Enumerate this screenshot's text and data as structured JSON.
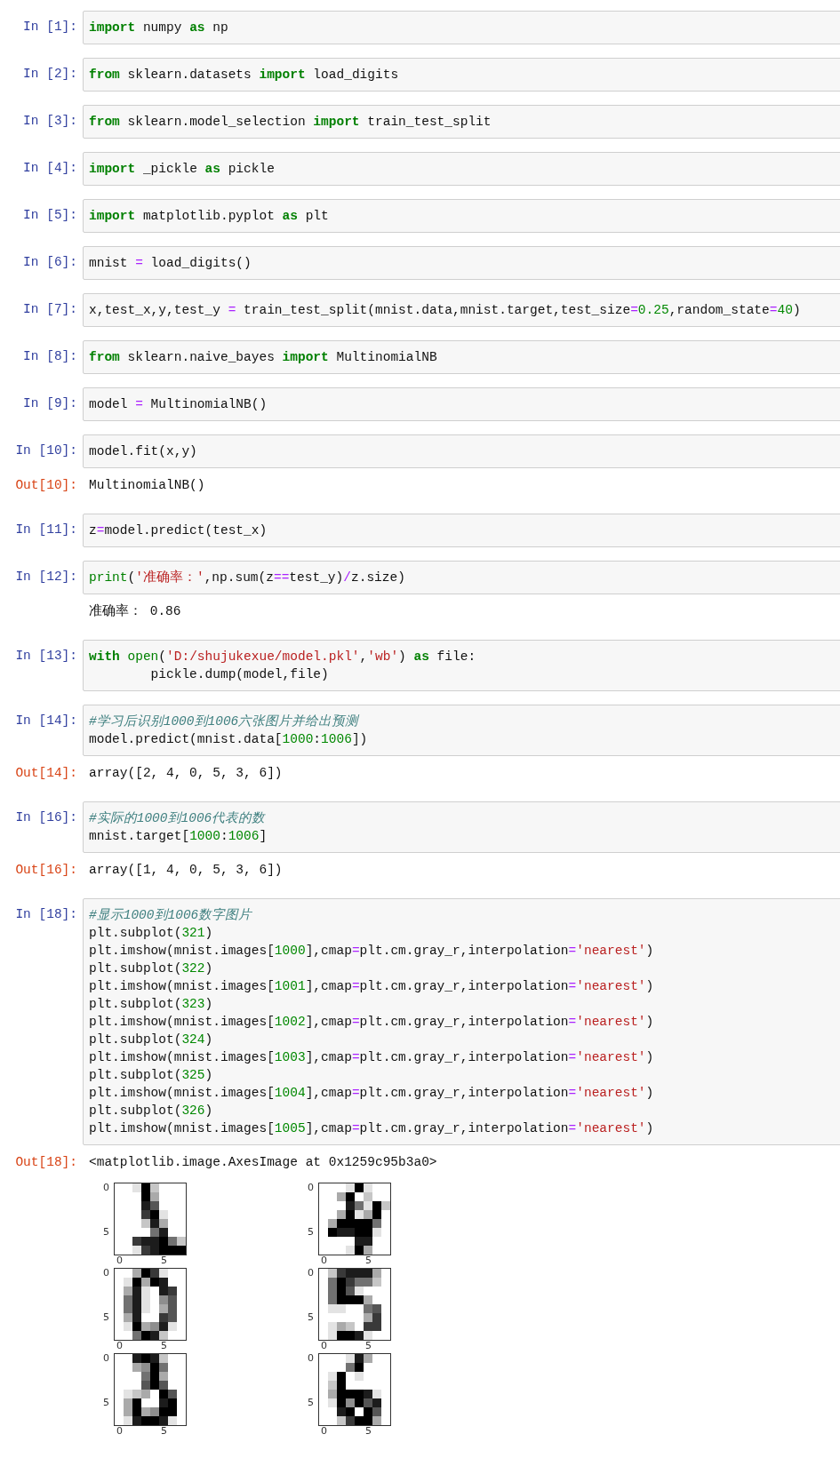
{
  "cells": [
    {
      "prompt": "In [1]:",
      "code": [
        [
          {
            "kind": "kw",
            "text": "import"
          },
          {
            "kind": "plain",
            "text": " numpy "
          },
          {
            "kind": "kw",
            "text": "as"
          },
          {
            "kind": "plain",
            "text": " np"
          }
        ]
      ]
    },
    {
      "prompt": "In [2]:",
      "code": [
        [
          {
            "kind": "kw",
            "text": "from"
          },
          {
            "kind": "plain",
            "text": " sklearn.datasets "
          },
          {
            "kind": "kw",
            "text": "import"
          },
          {
            "kind": "plain",
            "text": " load_digits"
          }
        ]
      ]
    },
    {
      "prompt": "In [3]:",
      "code": [
        [
          {
            "kind": "kw",
            "text": "from"
          },
          {
            "kind": "plain",
            "text": " sklearn.model_selection "
          },
          {
            "kind": "kw",
            "text": "import"
          },
          {
            "kind": "plain",
            "text": " train_test_split"
          }
        ]
      ]
    },
    {
      "prompt": "In [4]:",
      "code": [
        [
          {
            "kind": "kw",
            "text": "import"
          },
          {
            "kind": "plain",
            "text": " _pickle "
          },
          {
            "kind": "kw",
            "text": "as"
          },
          {
            "kind": "plain",
            "text": " pickle"
          }
        ]
      ]
    },
    {
      "prompt": "In [5]:",
      "code": [
        [
          {
            "kind": "kw",
            "text": "import"
          },
          {
            "kind": "plain",
            "text": " matplotlib.pyplot "
          },
          {
            "kind": "kw",
            "text": "as"
          },
          {
            "kind": "plain",
            "text": " plt"
          }
        ]
      ]
    },
    {
      "prompt": "In [6]:",
      "code": [
        [
          {
            "kind": "plain",
            "text": "mnist "
          },
          {
            "kind": "op",
            "text": "="
          },
          {
            "kind": "plain",
            "text": " load_digits()"
          }
        ]
      ]
    },
    {
      "prompt": "In [7]:",
      "code": [
        [
          {
            "kind": "plain",
            "text": "x,test_x,y,test_y "
          },
          {
            "kind": "op",
            "text": "="
          },
          {
            "kind": "plain",
            "text": " train_test_split(mnist.data,mnist.target,test_size"
          },
          {
            "kind": "op",
            "text": "="
          },
          {
            "kind": "num",
            "text": "0.25"
          },
          {
            "kind": "plain",
            "text": ",random_state"
          },
          {
            "kind": "op",
            "text": "="
          },
          {
            "kind": "num",
            "text": "40"
          },
          {
            "kind": "plain",
            "text": ")"
          }
        ]
      ]
    },
    {
      "prompt": "In [8]:",
      "code": [
        [
          {
            "kind": "kw",
            "text": "from"
          },
          {
            "kind": "plain",
            "text": " sklearn.naive_bayes "
          },
          {
            "kind": "kw",
            "text": "import"
          },
          {
            "kind": "plain",
            "text": " MultinomialNB"
          }
        ]
      ]
    },
    {
      "prompt": "In [9]:",
      "code": [
        [
          {
            "kind": "plain",
            "text": "model "
          },
          {
            "kind": "op",
            "text": "="
          },
          {
            "kind": "plain",
            "text": " MultinomialNB()"
          }
        ]
      ]
    },
    {
      "prompt": "In [10]:",
      "code": [
        [
          {
            "kind": "plain",
            "text": "model.fit(x,y)"
          }
        ]
      ],
      "outputs": [
        {
          "kind": "text",
          "prompt": "Out[10]:",
          "text": "MultinomialNB()"
        }
      ]
    },
    {
      "prompt": "In [11]:",
      "code": [
        [
          {
            "kind": "plain",
            "text": "z"
          },
          {
            "kind": "op",
            "text": "="
          },
          {
            "kind": "plain",
            "text": "model.predict(test_x)"
          }
        ]
      ]
    },
    {
      "prompt": "In [12]:",
      "code": [
        [
          {
            "kind": "builtin",
            "text": "print"
          },
          {
            "kind": "plain",
            "text": "("
          },
          {
            "kind": "str",
            "text": "'准确率：'"
          },
          {
            "kind": "plain",
            "text": ",np.sum(z"
          },
          {
            "kind": "op",
            "text": "=="
          },
          {
            "kind": "plain",
            "text": "test_y)"
          },
          {
            "kind": "op",
            "text": "/"
          },
          {
            "kind": "plain",
            "text": "z.size)"
          }
        ]
      ],
      "outputs": [
        {
          "kind": "text",
          "text": "准确率： 0.86"
        }
      ]
    },
    {
      "prompt": "In [13]:",
      "code": [
        [
          {
            "kind": "kw",
            "text": "with"
          },
          {
            "kind": "builtin",
            "text": " open"
          },
          {
            "kind": "plain",
            "text": "("
          },
          {
            "kind": "str",
            "text": "'D:/shujukexue/model.pkl'"
          },
          {
            "kind": "plain",
            "text": ","
          },
          {
            "kind": "str",
            "text": "'wb'"
          },
          {
            "kind": "plain",
            "text": ") "
          },
          {
            "kind": "kw",
            "text": "as"
          },
          {
            "kind": "plain",
            "text": " file:"
          }
        ],
        [
          {
            "kind": "plain",
            "text": "        pickle.dump(model,file)"
          }
        ]
      ]
    },
    {
      "prompt": "In [14]:",
      "code": [
        [
          {
            "kind": "comment",
            "text": "#学习后识别1000到1006六张图片并给出预测"
          }
        ],
        [
          {
            "kind": "plain",
            "text": "model.predict(mnist.data["
          },
          {
            "kind": "num",
            "text": "1000"
          },
          {
            "kind": "plain",
            "text": ":"
          },
          {
            "kind": "num",
            "text": "1006"
          },
          {
            "kind": "plain",
            "text": "])"
          }
        ]
      ],
      "outputs": [
        {
          "kind": "text",
          "prompt": "Out[14]:",
          "text": "array([2, 4, 0, 5, 3, 6])"
        }
      ]
    },
    {
      "prompt": "In [16]:",
      "code": [
        [
          {
            "kind": "comment",
            "text": "#实际的1000到1006代表的数"
          }
        ],
        [
          {
            "kind": "plain",
            "text": "mnist.target["
          },
          {
            "kind": "num",
            "text": "1000"
          },
          {
            "kind": "plain",
            "text": ":"
          },
          {
            "kind": "num",
            "text": "1006"
          },
          {
            "kind": "plain",
            "text": "]"
          }
        ]
      ],
      "outputs": [
        {
          "kind": "text",
          "prompt": "Out[16]:",
          "text": "array([1, 4, 0, 5, 3, 6])"
        }
      ]
    },
    {
      "prompt": "In [18]:",
      "code": [
        [
          {
            "kind": "comment",
            "text": "#显示1000到1006数字图片"
          }
        ],
        [
          {
            "kind": "plain",
            "text": "plt.subplot("
          },
          {
            "kind": "num",
            "text": "321"
          },
          {
            "kind": "plain",
            "text": ")"
          }
        ],
        [
          {
            "kind": "plain",
            "text": "plt.imshow(mnist.images["
          },
          {
            "kind": "num",
            "text": "1000"
          },
          {
            "kind": "plain",
            "text": "],cmap"
          },
          {
            "kind": "op",
            "text": "="
          },
          {
            "kind": "plain",
            "text": "plt.cm.gray_r,interpolation"
          },
          {
            "kind": "op",
            "text": "="
          },
          {
            "kind": "str",
            "text": "'nearest'"
          },
          {
            "kind": "plain",
            "text": ")"
          }
        ],
        [
          {
            "kind": "plain",
            "text": "plt.subplot("
          },
          {
            "kind": "num",
            "text": "322"
          },
          {
            "kind": "plain",
            "text": ")"
          }
        ],
        [
          {
            "kind": "plain",
            "text": "plt.imshow(mnist.images["
          },
          {
            "kind": "num",
            "text": "1001"
          },
          {
            "kind": "plain",
            "text": "],cmap"
          },
          {
            "kind": "op",
            "text": "="
          },
          {
            "kind": "plain",
            "text": "plt.cm.gray_r,interpolation"
          },
          {
            "kind": "op",
            "text": "="
          },
          {
            "kind": "str",
            "text": "'nearest'"
          },
          {
            "kind": "plain",
            "text": ")"
          }
        ],
        [
          {
            "kind": "plain",
            "text": "plt.subplot("
          },
          {
            "kind": "num",
            "text": "323"
          },
          {
            "kind": "plain",
            "text": ")"
          }
        ],
        [
          {
            "kind": "plain",
            "text": "plt.imshow(mnist.images["
          },
          {
            "kind": "num",
            "text": "1002"
          },
          {
            "kind": "plain",
            "text": "],cmap"
          },
          {
            "kind": "op",
            "text": "="
          },
          {
            "kind": "plain",
            "text": "plt.cm.gray_r,interpolation"
          },
          {
            "kind": "op",
            "text": "="
          },
          {
            "kind": "str",
            "text": "'nearest'"
          },
          {
            "kind": "plain",
            "text": ")"
          }
        ],
        [
          {
            "kind": "plain",
            "text": "plt.subplot("
          },
          {
            "kind": "num",
            "text": "324"
          },
          {
            "kind": "plain",
            "text": ")"
          }
        ],
        [
          {
            "kind": "plain",
            "text": "plt.imshow(mnist.images["
          },
          {
            "kind": "num",
            "text": "1003"
          },
          {
            "kind": "plain",
            "text": "],cmap"
          },
          {
            "kind": "op",
            "text": "="
          },
          {
            "kind": "plain",
            "text": "plt.cm.gray_r,interpolation"
          },
          {
            "kind": "op",
            "text": "="
          },
          {
            "kind": "str",
            "text": "'nearest'"
          },
          {
            "kind": "plain",
            "text": ")"
          }
        ],
        [
          {
            "kind": "plain",
            "text": "plt.subplot("
          },
          {
            "kind": "num",
            "text": "325"
          },
          {
            "kind": "plain",
            "text": ")"
          }
        ],
        [
          {
            "kind": "plain",
            "text": "plt.imshow(mnist.images["
          },
          {
            "kind": "num",
            "text": "1004"
          },
          {
            "kind": "plain",
            "text": "],cmap"
          },
          {
            "kind": "op",
            "text": "="
          },
          {
            "kind": "plain",
            "text": "plt.cm.gray_r,interpolation"
          },
          {
            "kind": "op",
            "text": "="
          },
          {
            "kind": "str",
            "text": "'nearest'"
          },
          {
            "kind": "plain",
            "text": ")"
          }
        ],
        [
          {
            "kind": "plain",
            "text": "plt.subplot("
          },
          {
            "kind": "num",
            "text": "326"
          },
          {
            "kind": "plain",
            "text": ")"
          }
        ],
        [
          {
            "kind": "plain",
            "text": "plt.imshow(mnist.images["
          },
          {
            "kind": "num",
            "text": "1005"
          },
          {
            "kind": "plain",
            "text": "],cmap"
          },
          {
            "kind": "op",
            "text": "="
          },
          {
            "kind": "plain",
            "text": "plt.cm.gray_r,interpolation"
          },
          {
            "kind": "op",
            "text": "="
          },
          {
            "kind": "str",
            "text": "'nearest'"
          },
          {
            "kind": "plain",
            "text": ")"
          }
        ]
      ],
      "outputs": [
        {
          "kind": "text",
          "prompt": "Out[18]:",
          "text": "<matplotlib.image.AxesImage at 0x1259c95b3a0>"
        },
        {
          "kind": "figure",
          "subplots": [
            {
              "yticks": [
                "0",
                "5"
              ],
              "xticks": [
                "0",
                "5"
              ]
            },
            {
              "yticks": [
                "0",
                "5"
              ],
              "xticks": [
                "0",
                "5"
              ]
            },
            {
              "yticks": [
                "0",
                "5"
              ],
              "xticks": [
                "0",
                "5"
              ]
            },
            {
              "yticks": [
                "0",
                "5"
              ],
              "xticks": [
                "0",
                "5"
              ]
            },
            {
              "yticks": [
                "0",
                "5"
              ],
              "xticks": [
                "0",
                "5"
              ]
            },
            {
              "yticks": [
                "0",
                "5"
              ],
              "xticks": [
                "0",
                "5"
              ]
            }
          ]
        }
      ]
    }
  ]
}
